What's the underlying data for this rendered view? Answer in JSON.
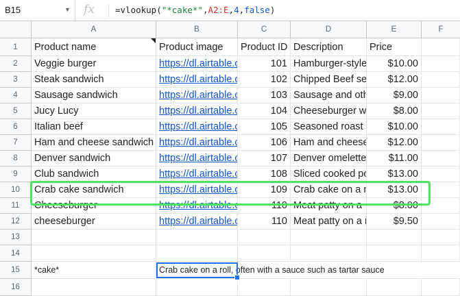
{
  "formula_bar": {
    "name_box": "B15",
    "fx_label": "fx",
    "formula_prefix": "=vlookup(",
    "formula_string": "\"*cake*\"",
    "formula_sep1": ",",
    "formula_range": "A2:E",
    "formula_sep2": ",",
    "formula_index": "4",
    "formula_sep3": ",",
    "formula_flag": "false",
    "formula_suffix": ")"
  },
  "columns": [
    "A",
    "B",
    "C",
    "D",
    "E",
    "F"
  ],
  "rows": [
    "1",
    "2",
    "3",
    "4",
    "5",
    "6",
    "7",
    "8",
    "9",
    "10",
    "11",
    "12",
    "13",
    "14",
    "15",
    "16"
  ],
  "header": {
    "a": "Product name",
    "b": "Product image",
    "c": "Product ID",
    "d": "Description",
    "e": "Price"
  },
  "data_rows": [
    {
      "name": "Veggie burger",
      "image": "https://dl.airtable.c",
      "id": "101",
      "desc": "Hamburger-style",
      "price": "$10.00"
    },
    {
      "name": "Steak sandwich",
      "image": "https://dl.airtable.c",
      "id": "102",
      "desc": "Chipped Beef se",
      "price": "$12.00"
    },
    {
      "name": "Sausage sandwich",
      "image": "https://dl.airtable.c",
      "id": "103",
      "desc": "Sausage and oth",
      "price": "$9.00"
    },
    {
      "name": "Jucy Lucy",
      "image": "https://dl.airtable.c",
      "id": "104",
      "desc": "Cheeseburger w",
      "price": "$8.00"
    },
    {
      "name": "Italian beef",
      "image": "https://dl.airtable.c",
      "id": "105",
      "desc": "Seasoned roast",
      "price": "$10.00"
    },
    {
      "name": "Ham and cheese sandwich",
      "image": "https://dl.airtable.c",
      "id": "106",
      "desc": "Ham and cheese",
      "price": "$12.00"
    },
    {
      "name": "Denver sandwich",
      "image": "https://dl.airtable.c",
      "id": "107",
      "desc": "Denver omelette",
      "price": "$11.00"
    },
    {
      "name": "Club sandwich",
      "image": "https://dl.airtable.c",
      "id": "108",
      "desc": "Sliced cooked po",
      "price": "$13.00"
    },
    {
      "name": "Crab cake sandwich",
      "image": "https://dl.airtable.c",
      "id": "109",
      "desc": "Crab cake on a r",
      "price": "$13.00"
    },
    {
      "name": "Cheeseburger",
      "image": "https://dl.airtable.c",
      "id": "110",
      "desc": "Meat patty on a",
      "price": "$8.00"
    },
    {
      "name": "cheeseburger",
      "image": "https://dl.airtable.c",
      "id": "110",
      "desc": "Meat patty on a r",
      "price": "$9.50"
    }
  ],
  "row15": {
    "a": "*cake*",
    "b": "Crab cake on a roll, often with a sauce such as tartar sauce"
  }
}
